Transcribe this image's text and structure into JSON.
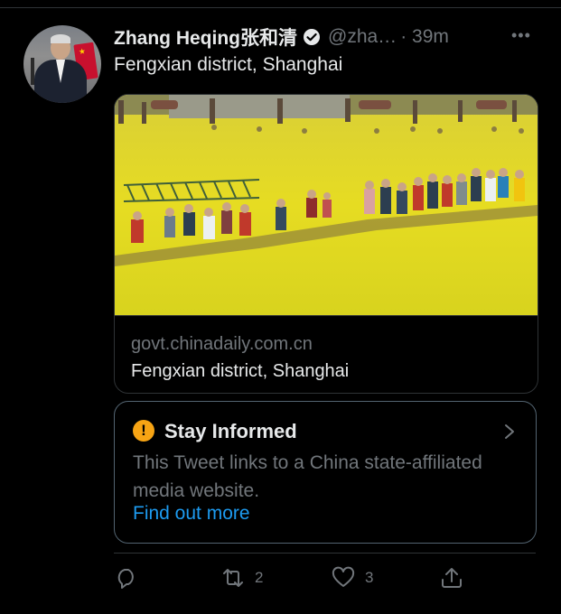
{
  "tweet": {
    "author_name": "Zhang Heqing张和清",
    "handle": "@zha…",
    "time": "· 39m",
    "more_icon": "more-horizontal-icon",
    "text": "Fengxian district, Shanghai"
  },
  "link_card": {
    "domain": "govt.chinadaily.com.cn",
    "title": "Fengxian district, Shanghai"
  },
  "notice": {
    "title": "Stay Informed",
    "body": "This Tweet links to a China state-affiliated media website.",
    "link": "Find out more"
  },
  "actions": {
    "reply_count": "",
    "retweet_count": "2",
    "like_count": "3"
  },
  "colors": {
    "background": "#000000",
    "text": "#e7e9ea",
    "secondary": "#71767b",
    "link": "#1d9bf0",
    "warning": "#f7a414"
  }
}
